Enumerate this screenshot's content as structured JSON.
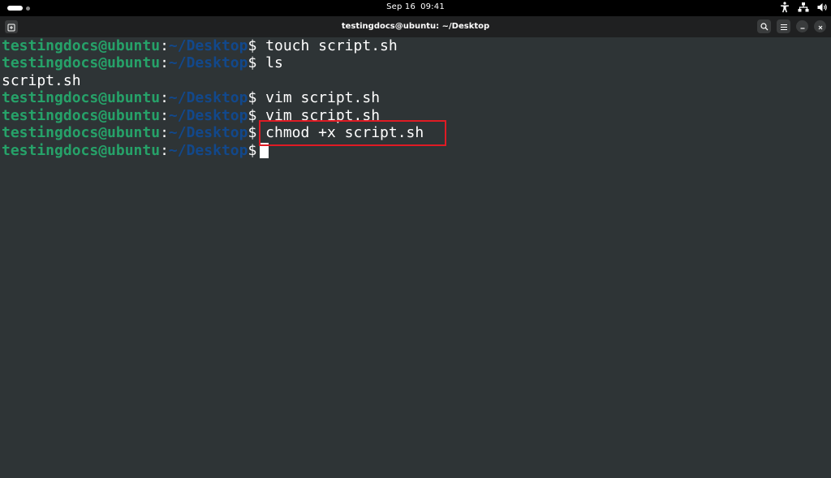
{
  "topbar": {
    "date": "Sep 16",
    "time": "09:41"
  },
  "window": {
    "title": "testingdocs@ubuntu: ~/Desktop"
  },
  "terminal": {
    "lines": [
      {
        "user": "testingdocs@ubuntu",
        "colon": ":",
        "path": "~/Desktop",
        "dollar": "$",
        "command": " touch script.sh"
      },
      {
        "user": "testingdocs@ubuntu",
        "colon": ":",
        "path": "~/Desktop",
        "dollar": "$",
        "command": " ls"
      },
      {
        "output": "script.sh"
      },
      {
        "user": "testingdocs@ubuntu",
        "colon": ":",
        "path": "~/Desktop",
        "dollar": "$",
        "command": " vim script.sh"
      },
      {
        "user": "testingdocs@ubuntu",
        "colon": ":",
        "path": "~/Desktop",
        "dollar": "$",
        "command": " vim script.sh"
      },
      {
        "user": "testingdocs@ubuntu",
        "colon": ":",
        "path": "~/Desktop",
        "dollar": "$",
        "command": " chmod +x script.sh"
      },
      {
        "user": "testingdocs@ubuntu",
        "colon": ":",
        "path": "~/Desktop",
        "dollar": "$",
        "command": ""
      }
    ]
  },
  "colors": {
    "terminal_bg": "#2e3436",
    "prompt_user": "#26a269",
    "prompt_path": "#12488b",
    "highlight": "#e01b24"
  },
  "icons": [
    "activities-indicator",
    "accessibility-icon",
    "network-icon",
    "volume-icon",
    "new-tab-icon",
    "search-icon",
    "menu-icon",
    "minimize-icon",
    "close-icon"
  ]
}
